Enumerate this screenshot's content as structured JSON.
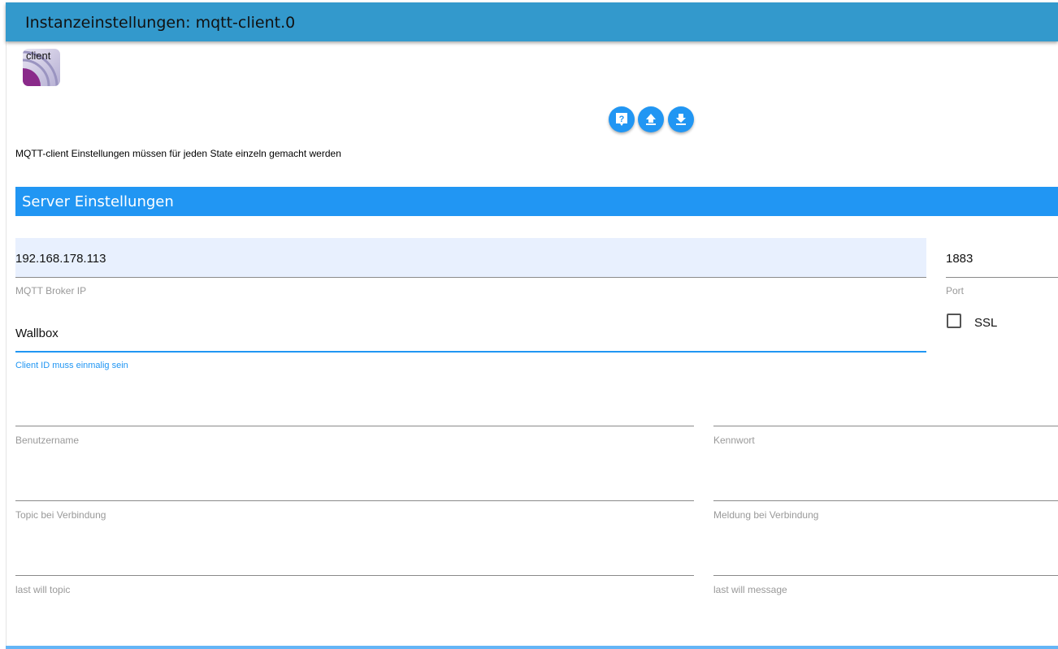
{
  "header": {
    "title": "Instanzeinstellungen: mqtt-client.0"
  },
  "logo": {
    "text": "client"
  },
  "toolbar": {
    "help_icon": "help-icon",
    "upload_icon": "upload-icon",
    "download_icon": "download-icon"
  },
  "note": "MQTT-client Einstellungen müssen für jeden State einzeln gemacht werden",
  "section": {
    "title": "Server Einstellungen"
  },
  "fields": {
    "broker_ip": {
      "value": "192.168.178.113",
      "label": "MQTT Broker IP"
    },
    "port": {
      "value": "1883",
      "label": "Port"
    },
    "ssl": {
      "label": "SSL",
      "checked": false
    },
    "client_id": {
      "value": "Wallbox",
      "label": "Client ID muss einmalig sein"
    },
    "username": {
      "value": "",
      "label": "Benutzername"
    },
    "password": {
      "value": "",
      "label": "Kennwort"
    },
    "topic_connect": {
      "value": "",
      "label": "Topic bei Verbindung"
    },
    "message_connect": {
      "value": "",
      "label": "Meldung bei Verbindung"
    },
    "lw_topic": {
      "value": "",
      "label": "last will topic"
    },
    "lw_message": {
      "value": "",
      "label": "last will message"
    }
  },
  "colors": {
    "header": "#3399cc",
    "accent": "#2196f3"
  }
}
